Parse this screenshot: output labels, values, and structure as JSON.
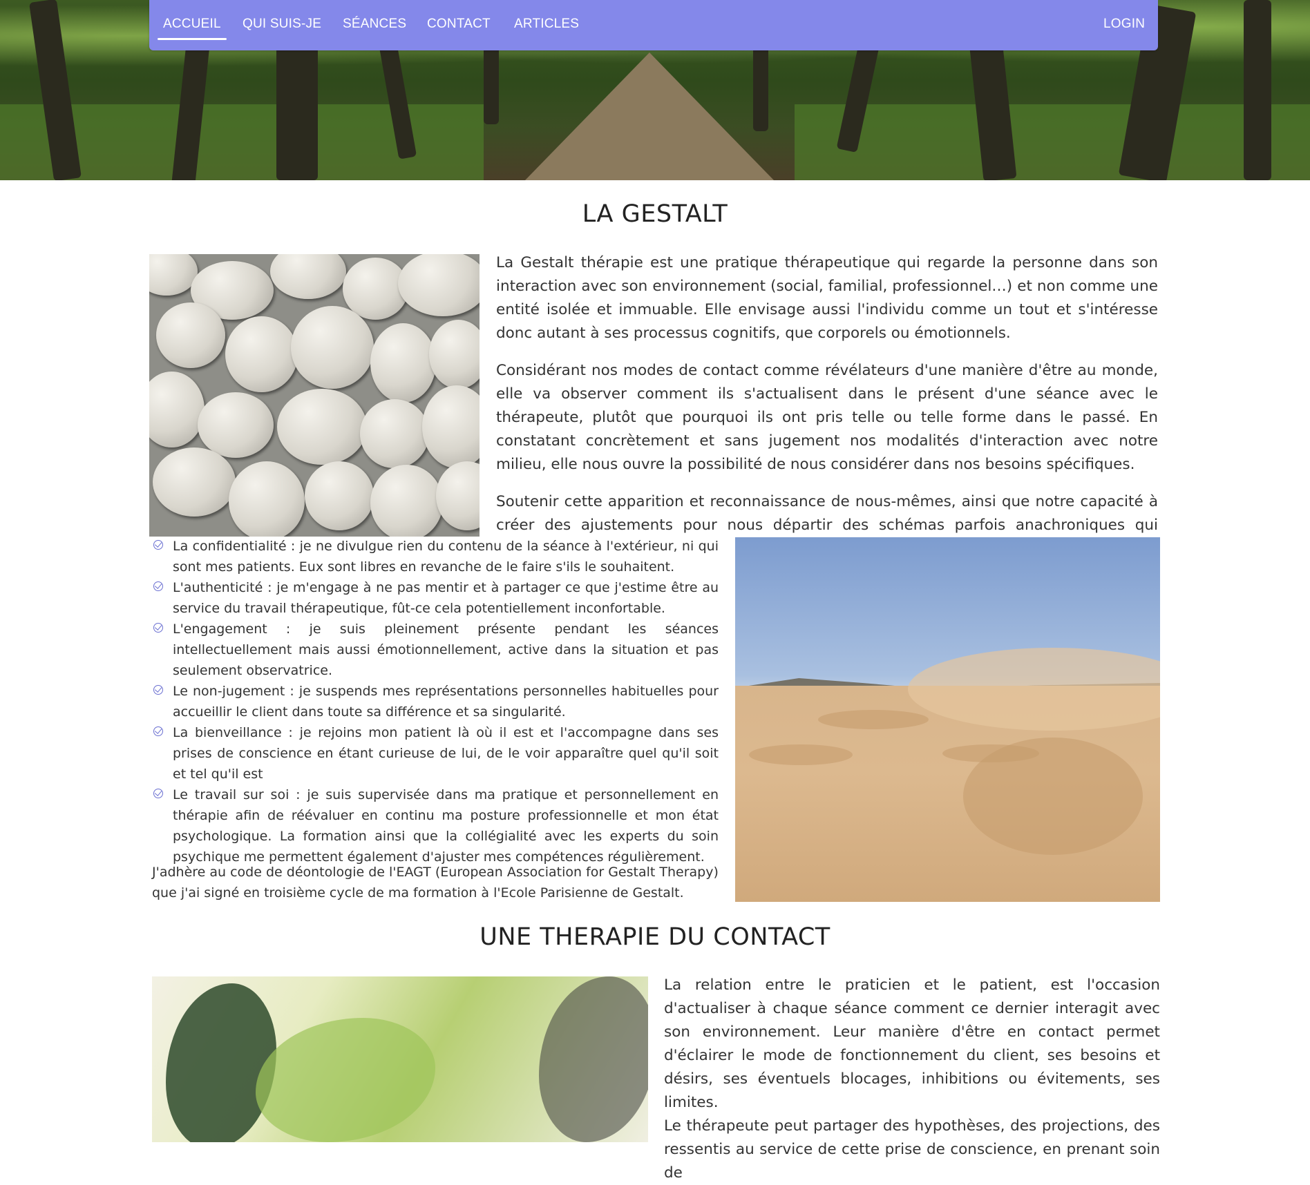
{
  "nav": {
    "items": [
      {
        "label": "ACCUEIL",
        "active": true
      },
      {
        "label": "QUI SUIS-JE",
        "active": false
      },
      {
        "label": "SÉANCES",
        "active": false
      },
      {
        "label": "CONTACT",
        "active": false
      },
      {
        "label": "ARTICLES",
        "active": false
      }
    ],
    "login": "LOGIN",
    "background_color": "#8488ea"
  },
  "gestalt": {
    "title": "LA GESTALT",
    "paragraphs": [
      "La Gestalt thérapie est une pratique thérapeutique qui regarde la personne dans son interaction avec son environnement (social, familial, professionnel…) et non comme une entité isolée et immuable. Elle envisage aussi l'individu comme un tout et s'intéresse donc autant à ses processus cognitifs, que corporels ou émotionnels.",
      "Considérant nos modes de contact comme révélateurs d'une manière d'être au monde, elle va observer comment ils s'actualisent dans le présent d'une séance avec le thérapeute, plutôt que pourquoi ils ont pris telle ou telle forme dans le passé. En constatant concrètement et sans jugement nos modalités d'interaction avec notre milieu, elle nous ouvre la possibilité de nous considérer dans nos besoins spécifiques.",
      "Soutenir cette apparition et reconnaissance de nous-mêmes, ainsi que notre capacité à créer des ajustements pour nous départir des schémas parfois anachroniques qui guident"
    ]
  },
  "values": [
    "La confidentialité : je ne divulgue rien du contenu de la séance à l'extérieur, ni qui sont mes patients. Eux sont libres en revanche de le faire s'ils le souhaitent.",
    "L'authenticité : je m'engage à ne pas mentir et à partager ce que j'estime être au service du travail thérapeutique, fût-ce cela potentiellement inconfortable.",
    "L'engagement : je suis pleinement présente pendant les séances intellectuellement mais aussi émotionnellement, active dans la situation et pas seulement observatrice.",
    "Le non-jugement : je suspends mes représentations personnelles habituelles pour accueillir le client dans toute sa différence et sa singularité.",
    "La bienveillance : je rejoins mon patient là où il est et l'accompagne dans ses prises de conscience en étant curieuse de lui, de le voir apparaître quel qu'il soit et tel qu'il est",
    "Le travail sur soi : je suis supervisée dans ma pratique et personnellement en thérapie afin de réévaluer en continu ma posture professionnelle et mon état psychologique. La formation ainsi que la collégialité avec les experts du soin psychique me permettent également d'ajuster mes compétences régulièrement."
  ],
  "eagt_note": "J'adhère au code de déontologie de l'EAGT (European Association for Gestalt Therapy) que j'ai signé en troisième cycle de ma formation à l'Ecole Parisienne de Gestalt.",
  "contact": {
    "title": "UNE THERAPIE DU CONTACT",
    "paragraphs": [
      "La relation entre le praticien et le patient, est l'occasion d'actualiser à chaque séance comment ce dernier interagit avec son environnement. Leur manière d'être en contact permet d'éclairer le mode de fonctionnement du client, ses besoins et désirs, ses éventuels blocages, inhibitions ou évitements, ses limites.",
      "Le thérapeute peut partager des hypothèses, des projections, des ressentis au service de cette prise de conscience, en prenant soin de"
    ]
  },
  "icons": {
    "list_bullet": "circle-check-icon"
  }
}
